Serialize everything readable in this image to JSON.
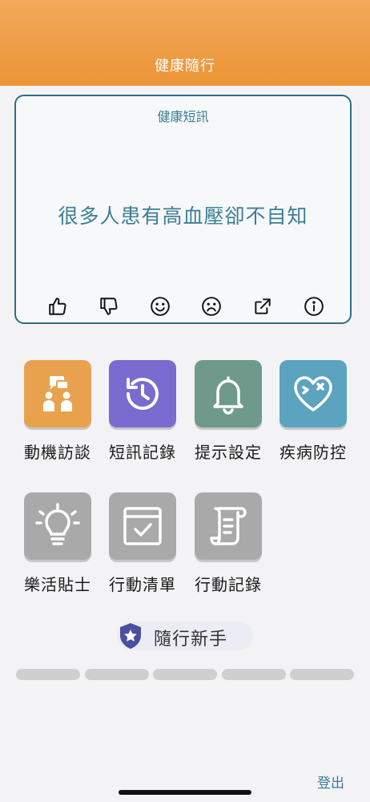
{
  "header": {
    "title": "健康隨行"
  },
  "message_card": {
    "title": "健康短訊",
    "message": "很多人患有高血壓卻不自知",
    "actions": [
      "like-icon",
      "dislike-icon",
      "smile-icon",
      "sad-icon",
      "share-icon",
      "info-icon"
    ]
  },
  "menu": {
    "items": [
      {
        "label": "動機訪談",
        "icon": "people-chat-icon",
        "color": "#e8a24e"
      },
      {
        "label": "短訊記錄",
        "icon": "history-icon",
        "color": "#7a6bd0"
      },
      {
        "label": "提示設定",
        "icon": "bell-icon",
        "color": "#6f9a8b"
      },
      {
        "label": "疾病防控",
        "icon": "heart-bandage-icon",
        "color": "#5ba3bf"
      },
      {
        "label": "樂活貼士",
        "icon": "lightbulb-icon",
        "color": "#a9a9a9"
      },
      {
        "label": "行動清單",
        "icon": "checklist-icon",
        "color": "#a9a9a9"
      },
      {
        "label": "行動記錄",
        "icon": "scroll-icon",
        "color": "#a9a9a9"
      }
    ]
  },
  "rank": {
    "label": "隨行新手",
    "icon": "star-shield-icon",
    "color": "#4a4fa0"
  },
  "progress": {
    "completed_segments": 0,
    "total_segments": 5
  },
  "footer": {
    "logout_label": "登出"
  }
}
